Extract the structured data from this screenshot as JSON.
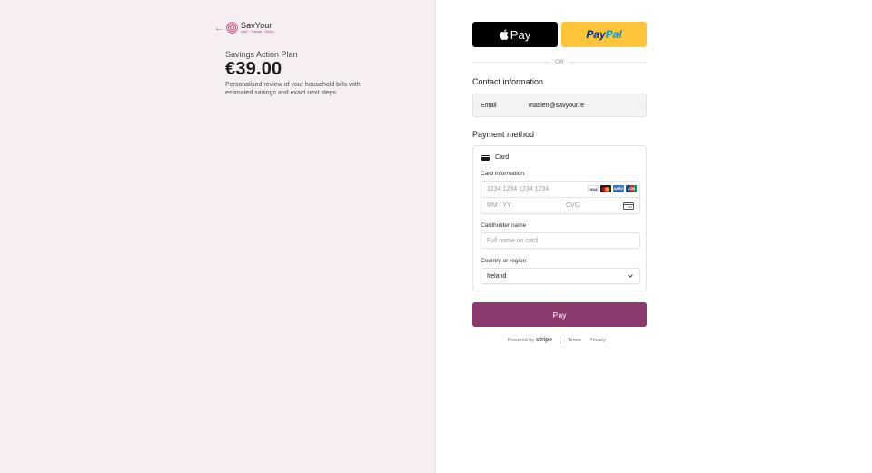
{
  "brand": {
    "name": "SavYour",
    "tagline": "Save · Change · Money",
    "colors": {
      "pink": "#c33a7a",
      "pay_button": "#8b3a6e",
      "left_bg": "#f7eef3"
    }
  },
  "summary": {
    "product_name": "Savings Action Plan",
    "price": "€39.00",
    "description": "Personalised review of your household bills with estimated savings and exact next steps."
  },
  "wallets": {
    "apple_pay_label": "Pay",
    "paypal_part1": "Pay",
    "paypal_part2": "Pal"
  },
  "divider_text": "OR",
  "contact": {
    "title": "Contact information",
    "email_label": "Email",
    "email_value": "maslen@savyour.ie"
  },
  "payment": {
    "title": "Payment method",
    "method_label": "Card",
    "card_info_label": "Card information",
    "card_number_placeholder": "1234 1234 1234 1234",
    "card_brands": [
      "VISA",
      "Mastercard",
      "AMEX",
      "JCB"
    ],
    "expiry_placeholder": "MM / YY",
    "cvc_placeholder": "CVC",
    "cardholder_label": "Cardholder name",
    "cardholder_placeholder": "Full name on card",
    "country_label": "Country or region",
    "country_value": "Ireland"
  },
  "pay_button_label": "Pay",
  "footer": {
    "powered_by": "Powered by",
    "stripe": "stripe",
    "terms": "Terms",
    "privacy": "Privacy"
  }
}
